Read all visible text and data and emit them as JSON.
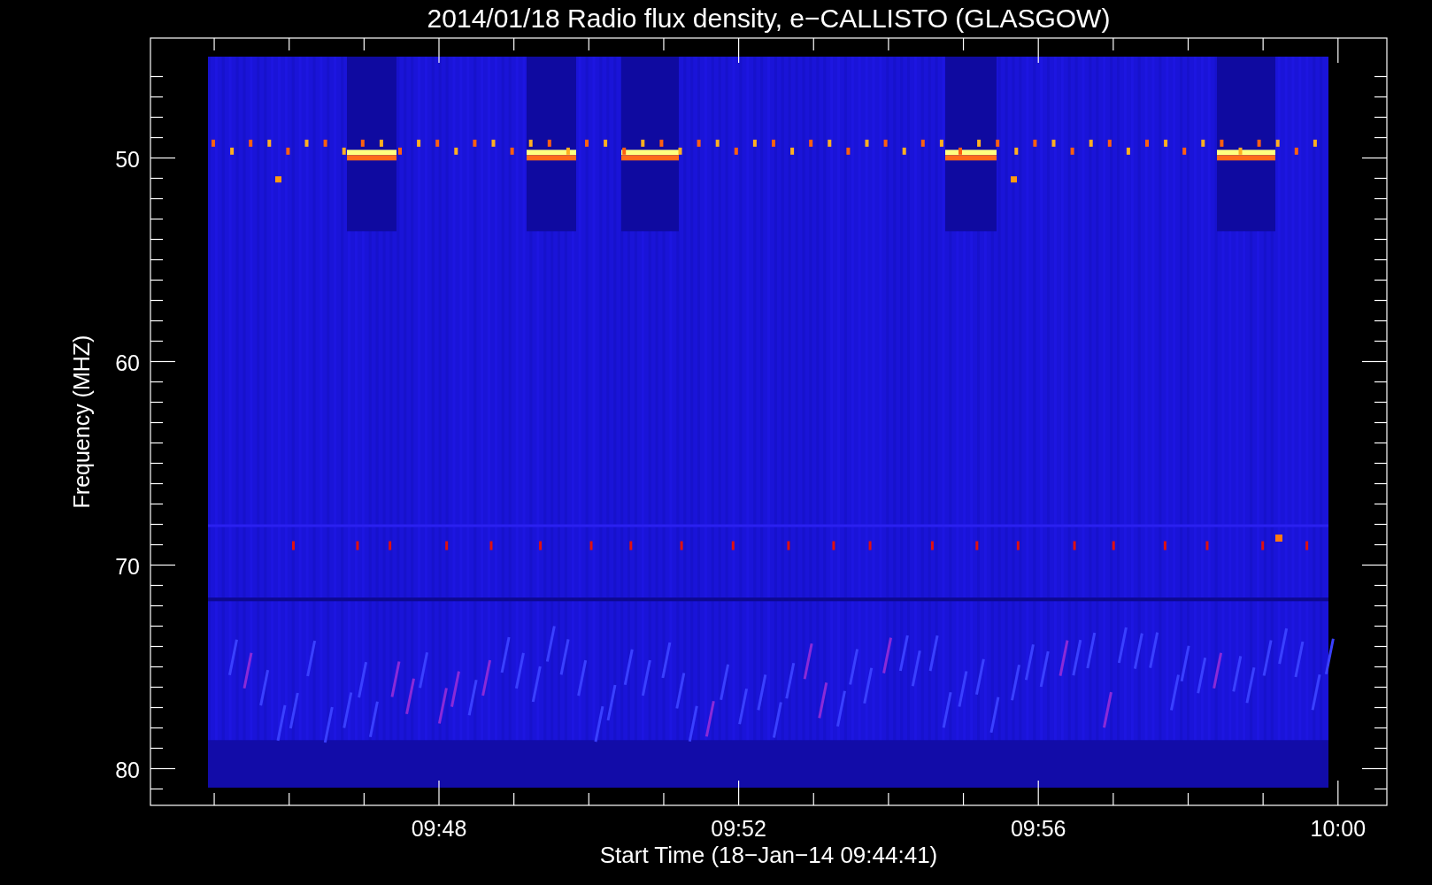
{
  "title": "2014/01/18  Radio flux density, e−CALLISTO (GLASGOW)",
  "y_axis": {
    "label": "Frequency (MHZ)",
    "ticks": [
      "50",
      "60",
      "70",
      "80"
    ]
  },
  "x_axis": {
    "label": "Start Time (18−Jan−14 09:44:41)",
    "ticks": [
      "09:48",
      "09:52",
      "09:56",
      "10:00"
    ]
  }
}
